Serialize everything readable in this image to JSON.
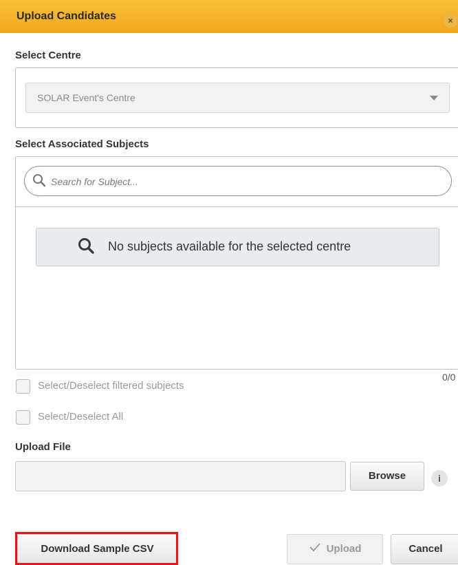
{
  "dialog": {
    "title": "Upload Candidates",
    "close_icon": "close-icon",
    "close_symbol": "×"
  },
  "centre": {
    "label": "Select Centre",
    "selected": "SOLAR Event's Centre"
  },
  "subjects": {
    "label": "Select Associated Subjects",
    "search_placeholder": "Search for Subject...",
    "empty_message": "No subjects available for the selected centre",
    "count": "0/0",
    "select_filtered_label": "Select/Deselect filtered subjects",
    "select_all_label": "Select/Deselect All"
  },
  "upload_file": {
    "label": "Upload File",
    "browse_label": "Browse",
    "info_symbol": "i"
  },
  "footer": {
    "download_sample_label": "Download Sample CSV",
    "upload_label": "Upload",
    "cancel_label": "Cancel"
  },
  "colors": {
    "header_gradient_top": "#f9c13a",
    "header_gradient_bottom": "#f2a51f",
    "highlight_border": "#e8161a"
  }
}
